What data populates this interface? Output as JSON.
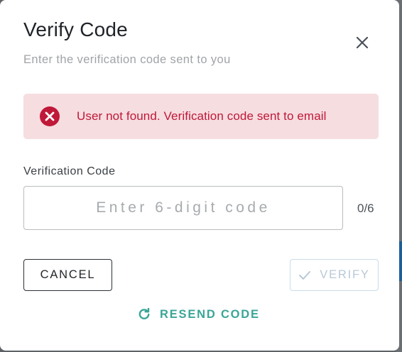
{
  "dialog": {
    "title": "Verify Code",
    "subtitle": "Enter the verification code sent to you",
    "close_icon": "close-icon"
  },
  "alert": {
    "severity": "error",
    "icon": "error-circle-icon",
    "message": "User not found. Verification code sent to email",
    "color": "#c01838",
    "background": "#f6dde0"
  },
  "code_field": {
    "label": "Verification Code",
    "placeholder": "Enter 6-digit code",
    "value": "",
    "counter": "0/6"
  },
  "actions": {
    "cancel_label": "CANCEL",
    "verify_label": "VERIFY",
    "verify_icon": "check-icon",
    "verify_disabled": true,
    "resend_label": "RESEND CODE",
    "resend_icon": "refresh-icon",
    "accent_color": "#3aa597"
  }
}
